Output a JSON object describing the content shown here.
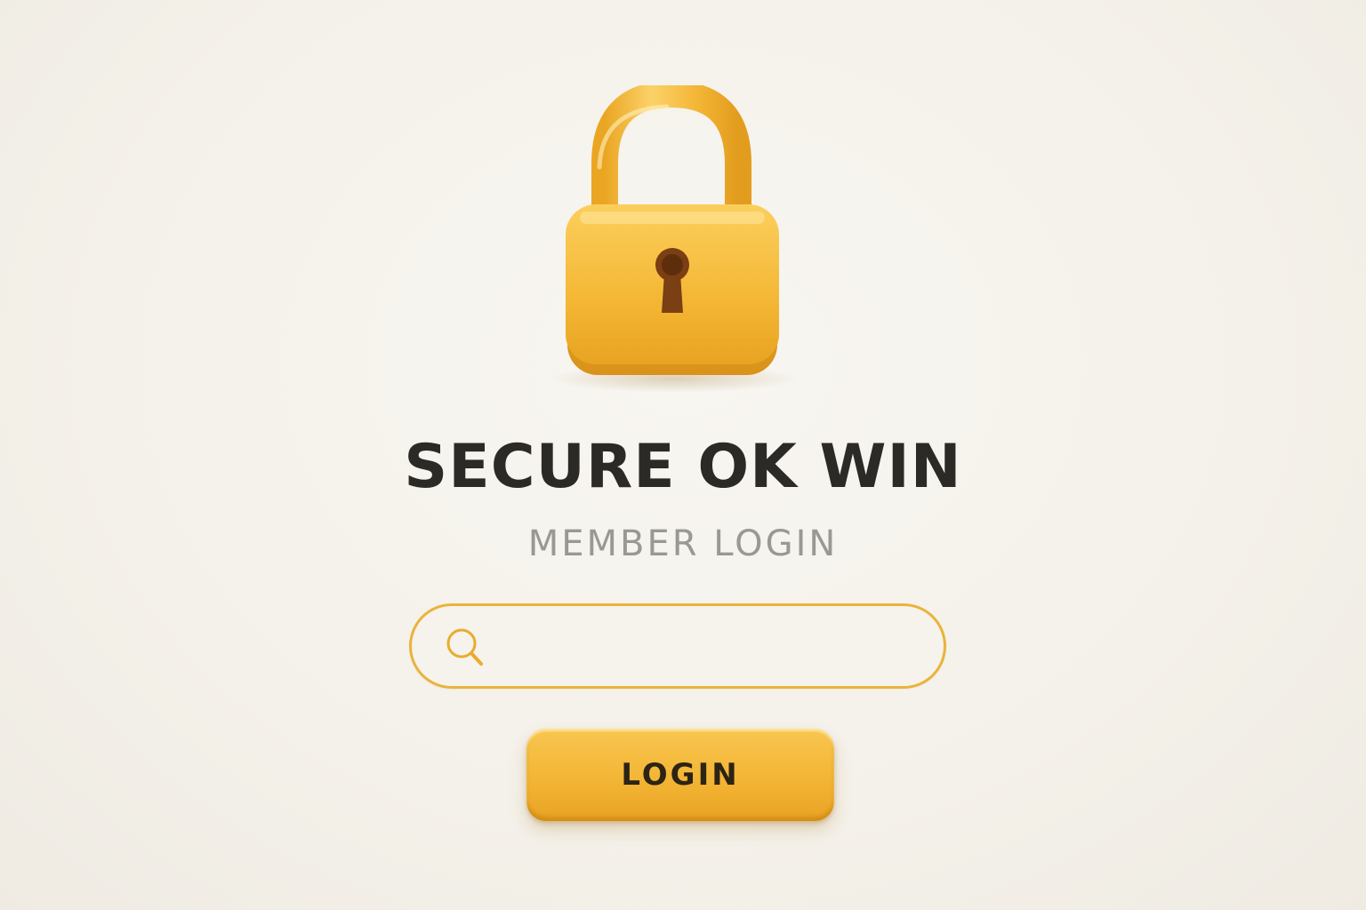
{
  "brand": {
    "title": "SECURE OK WIN",
    "subtitle": "MEMBER LOGIN"
  },
  "lock": {
    "icon": "padlock-icon",
    "keyhole_icon": "keyhole-icon",
    "color": "#f2b630"
  },
  "search": {
    "icon": "search-icon",
    "value": "",
    "placeholder": "",
    "border_color": "#eab33a"
  },
  "login_button": {
    "label": "LOGIN",
    "color": "#f3b535"
  },
  "colors": {
    "background": "#f6f3ee",
    "title": "#2b2a27",
    "subtitle": "#9a9894",
    "accent": "#f2b630"
  }
}
